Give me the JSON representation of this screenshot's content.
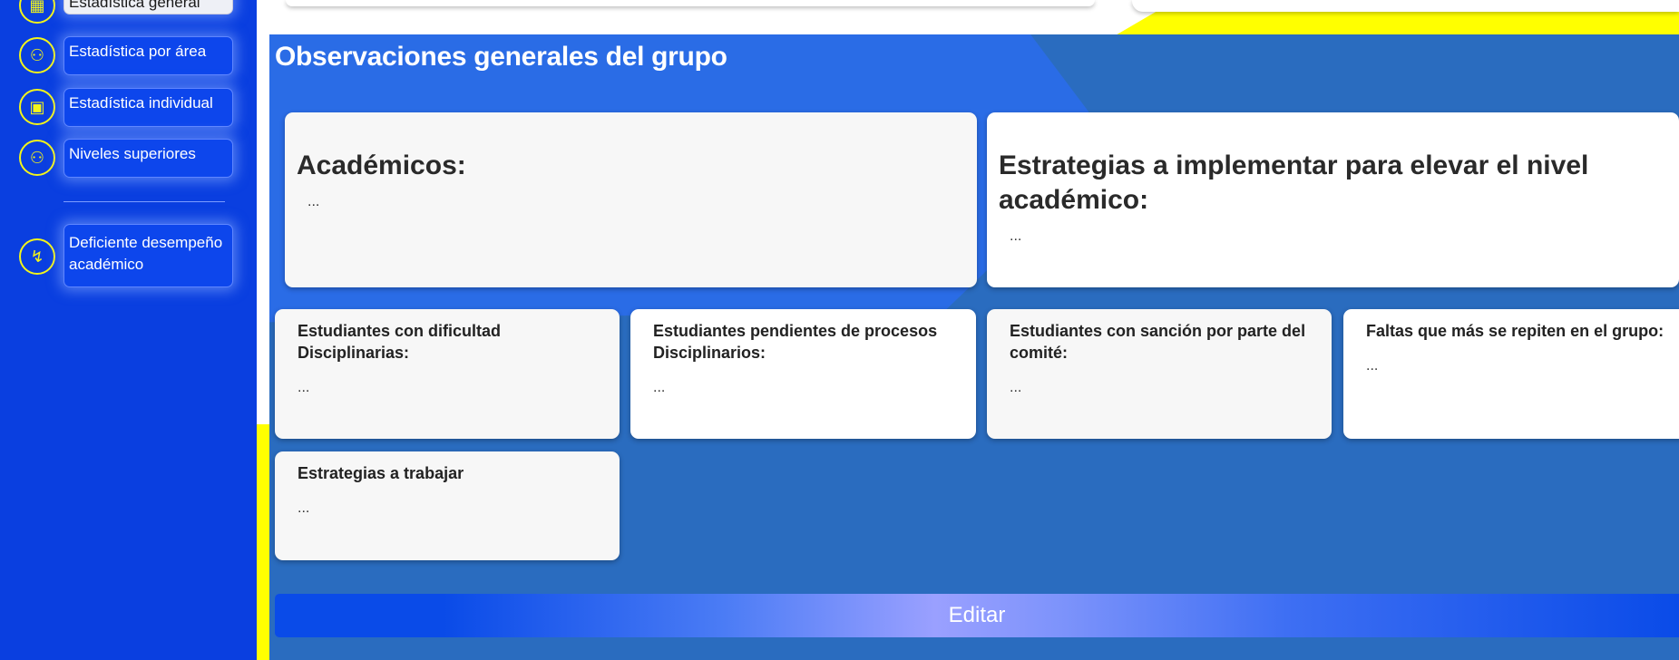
{
  "sidebar": {
    "items": [
      {
        "label": "Estadística general",
        "icon": "building-icon"
      },
      {
        "label": "Estadística por área",
        "icon": "group-icon"
      },
      {
        "label": "Estadística individual",
        "icon": "id-card-icon"
      },
      {
        "label": "Niveles superiores",
        "icon": "group-icon"
      },
      {
        "label": "Deficiente desempeño académico",
        "icon": "trend-down-icon"
      }
    ]
  },
  "panel": {
    "title": "Observaciones generales del grupo",
    "academicos": {
      "title": "Académicos:",
      "text": "..."
    },
    "estrategias_nivel": {
      "title": "Estrategias a implementar para elevar el nivel académico:",
      "text": "..."
    },
    "cards": [
      {
        "title": "Estudiantes con dificultad Disciplinarias:",
        "text": "..."
      },
      {
        "title": "Estudiantes pendientes de procesos Disciplinarios:",
        "text": "..."
      },
      {
        "title": "Estudiantes con sanción por parte del comité:",
        "text": "..."
      },
      {
        "title": "Faltas que más se repiten en el grupo:",
        "text": "..."
      },
      {
        "title": "Estrategias a trabajar",
        "text": "..."
      }
    ],
    "edit_label": "Editar"
  },
  "colors": {
    "sidebar_bg": "#0a3fe0",
    "accent_yellow": "#ffff00",
    "panel_bg": "#2a6cbf",
    "panel_highlight": "#2a6ce6"
  }
}
